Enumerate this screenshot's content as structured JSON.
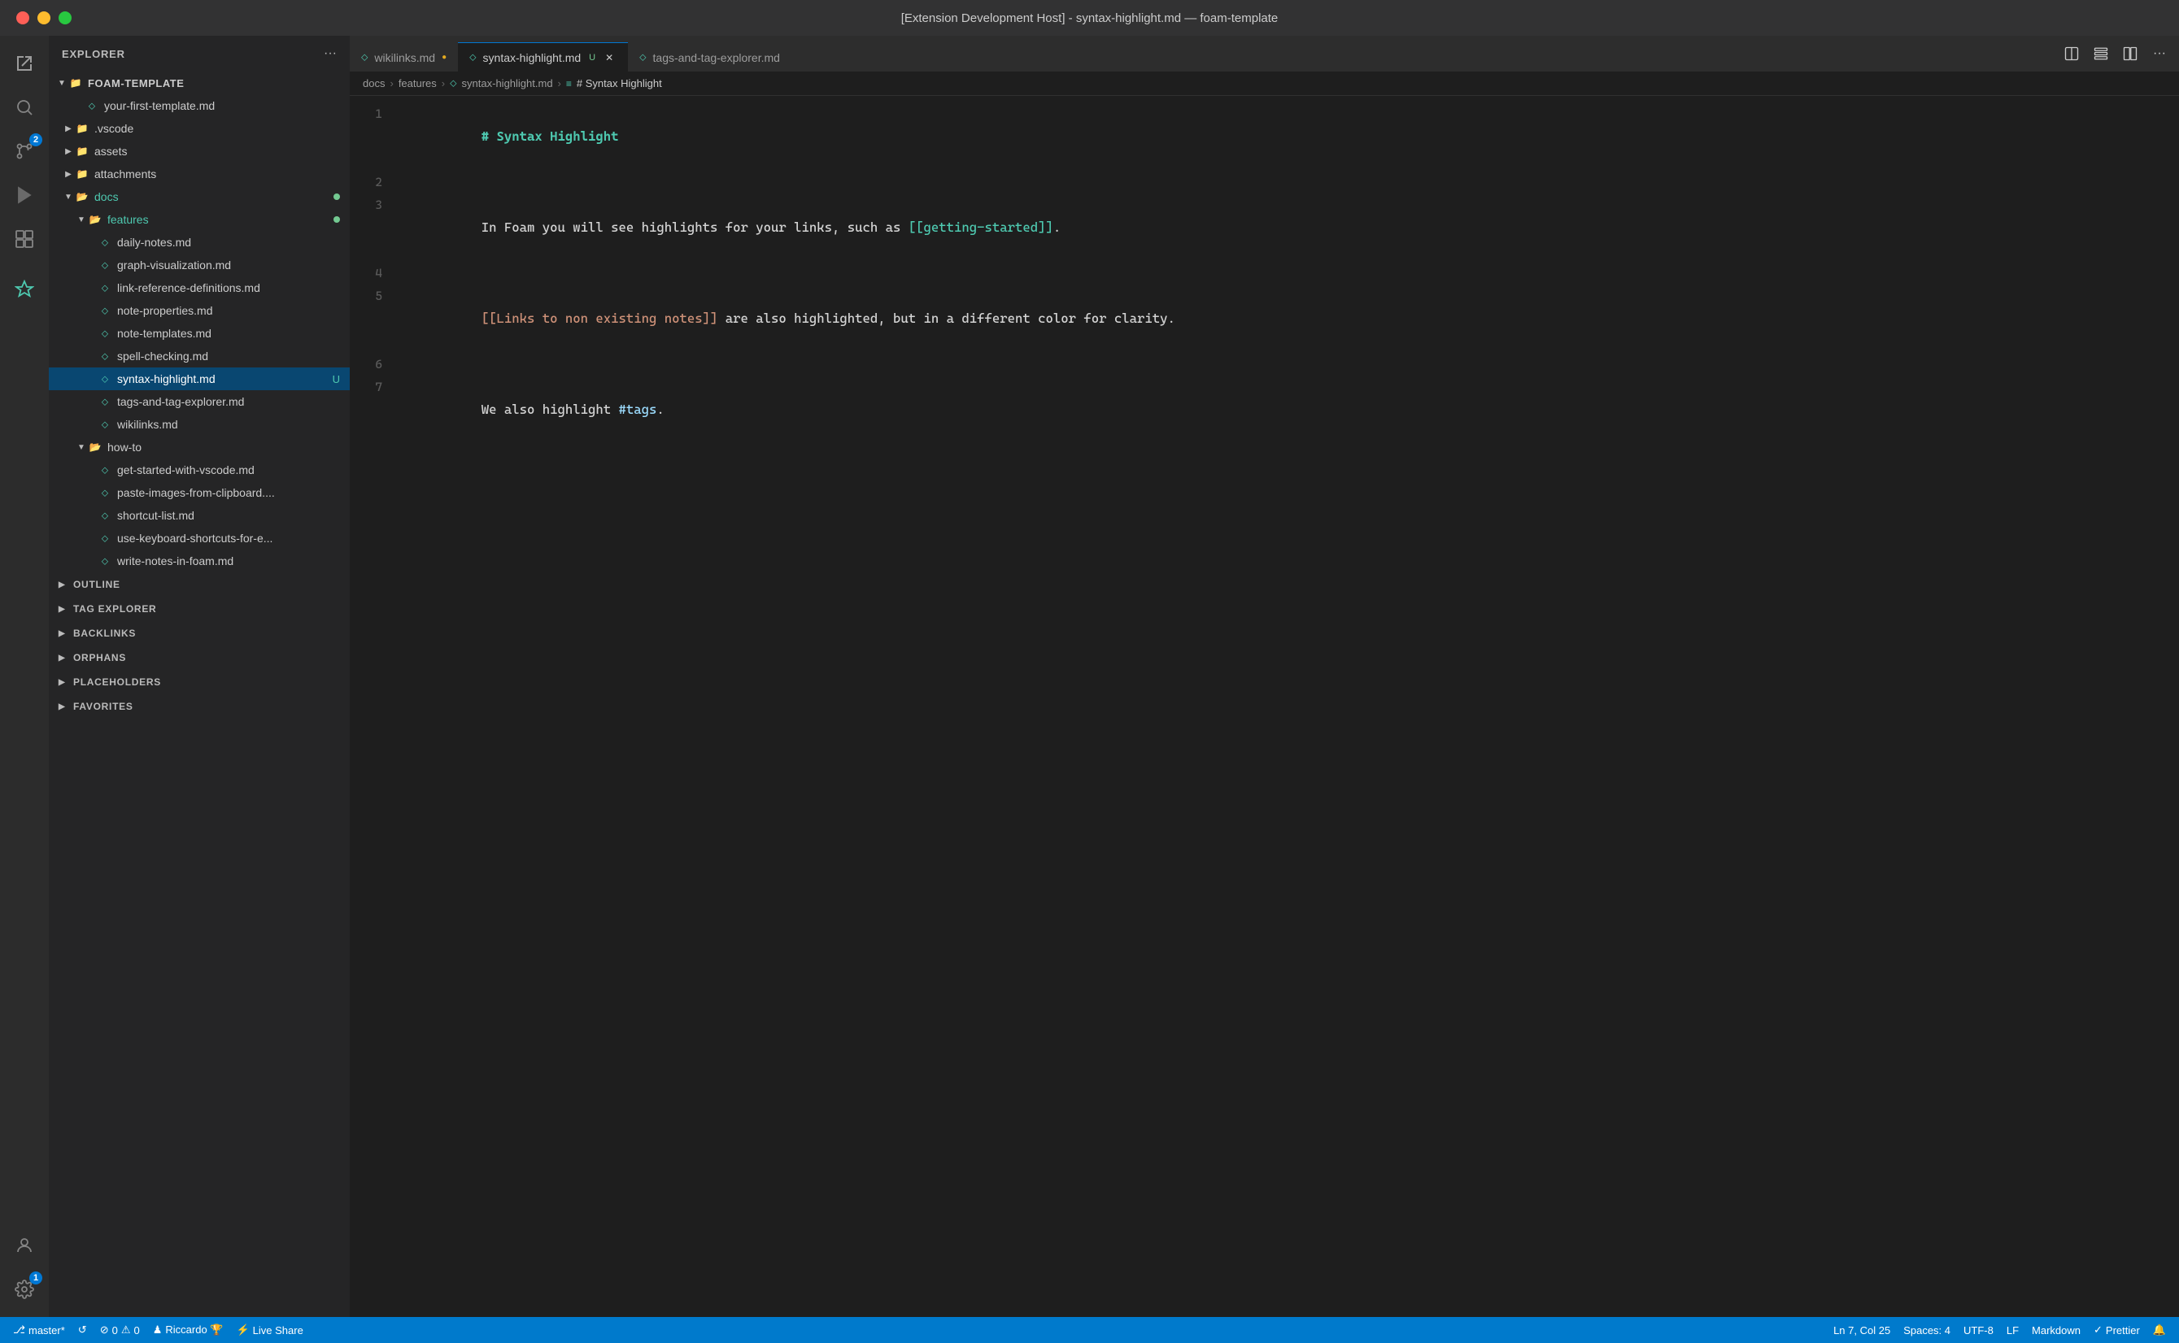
{
  "titlebar": {
    "title": "[Extension Development Host] - syntax-highlight.md — foam-template"
  },
  "activity_bar": {
    "icons": [
      {
        "name": "explorer-icon",
        "symbol": "⎘",
        "active": true,
        "badge": null
      },
      {
        "name": "search-icon",
        "symbol": "🔍",
        "active": false,
        "badge": null
      },
      {
        "name": "source-control-icon",
        "symbol": "⑂",
        "active": false,
        "badge": "2"
      },
      {
        "name": "run-icon",
        "symbol": "▷",
        "active": false,
        "badge": null
      },
      {
        "name": "extensions-icon",
        "symbol": "⊞",
        "active": false,
        "badge": null
      },
      {
        "name": "foam-icon",
        "symbol": "◈",
        "active": false,
        "badge": null
      }
    ],
    "bottom_icons": [
      {
        "name": "account-icon",
        "symbol": "👤",
        "badge": null
      },
      {
        "name": "settings-icon",
        "symbol": "⚙",
        "badge": "1"
      }
    ]
  },
  "sidebar": {
    "header": "EXPLORER",
    "tree": {
      "root": "FOAM-TEMPLATE",
      "items": [
        {
          "id": "your-first-template",
          "label": "your-first-template.md",
          "depth": 1,
          "type": "file",
          "indent": 28
        },
        {
          "id": "vscode",
          "label": ".vscode",
          "depth": 1,
          "type": "folder-closed",
          "indent": 16
        },
        {
          "id": "assets",
          "label": "assets",
          "depth": 1,
          "type": "folder-closed",
          "indent": 16
        },
        {
          "id": "attachments",
          "label": "attachments",
          "depth": 1,
          "type": "folder-closed",
          "indent": 16
        },
        {
          "id": "docs",
          "label": "docs",
          "depth": 1,
          "type": "folder-open",
          "indent": 16,
          "dot": true
        },
        {
          "id": "features",
          "label": "features",
          "depth": 2,
          "type": "folder-open",
          "indent": 32,
          "dot": true
        },
        {
          "id": "daily-notes",
          "label": "daily-notes.md",
          "depth": 3,
          "type": "file",
          "indent": 60
        },
        {
          "id": "graph-viz",
          "label": "graph-visualization.md",
          "depth": 3,
          "type": "file",
          "indent": 60
        },
        {
          "id": "link-ref",
          "label": "link-reference-definitions.md",
          "depth": 3,
          "type": "file",
          "indent": 60
        },
        {
          "id": "note-props",
          "label": "note-properties.md",
          "depth": 3,
          "type": "file",
          "indent": 60
        },
        {
          "id": "note-templ",
          "label": "note-templates.md",
          "depth": 3,
          "type": "file",
          "indent": 60
        },
        {
          "id": "spell-check",
          "label": "spell-checking.md",
          "depth": 3,
          "type": "file",
          "indent": 60
        },
        {
          "id": "syntax-highlight",
          "label": "syntax-highlight.md",
          "depth": 3,
          "type": "file",
          "indent": 60,
          "selected": true,
          "badge": "U"
        },
        {
          "id": "tags-explorer",
          "label": "tags-and-tag-explorer.md",
          "depth": 3,
          "type": "file",
          "indent": 60
        },
        {
          "id": "wikilinks",
          "label": "wikilinks.md",
          "depth": 3,
          "type": "file",
          "indent": 60
        },
        {
          "id": "how-to",
          "label": "how-to",
          "depth": 2,
          "type": "folder-open",
          "indent": 32
        },
        {
          "id": "get-started",
          "label": "get-started-with-vscode.md",
          "depth": 3,
          "type": "file",
          "indent": 60
        },
        {
          "id": "paste-images",
          "label": "paste-images-from-clipboard....",
          "depth": 3,
          "type": "file",
          "indent": 60
        },
        {
          "id": "shortcut-list",
          "label": "shortcut-list.md",
          "depth": 3,
          "type": "file",
          "indent": 60
        },
        {
          "id": "use-keyboard",
          "label": "use-keyboard-shortcuts-for-e...",
          "depth": 3,
          "type": "file",
          "indent": 60
        },
        {
          "id": "write-notes",
          "label": "write-notes-in-foam.md",
          "depth": 3,
          "type": "file",
          "indent": 60
        }
      ]
    },
    "sections": [
      {
        "id": "outline",
        "label": "OUTLINE",
        "expanded": false
      },
      {
        "id": "tag-explorer",
        "label": "TAG EXPLORER",
        "expanded": false
      },
      {
        "id": "backlinks",
        "label": "BACKLINKS",
        "expanded": false
      },
      {
        "id": "orphans",
        "label": "ORPHANS",
        "expanded": false
      },
      {
        "id": "placeholders",
        "label": "PLACEHOLDERS",
        "expanded": false
      },
      {
        "id": "favorites",
        "label": "FAVORITES",
        "expanded": false
      }
    ]
  },
  "tabs": [
    {
      "id": "wikilinks",
      "label": "wikilinks.md",
      "dirty": true,
      "active": false
    },
    {
      "id": "syntax-highlight",
      "label": "syntax-highlight.md",
      "dirty": false,
      "modified": true,
      "active": true
    },
    {
      "id": "tags-and-tag-explorer",
      "label": "tags-and-tag-explorer.md",
      "dirty": false,
      "active": false
    }
  ],
  "breadcrumb": {
    "items": [
      "docs",
      "features",
      "syntax-highlight.md",
      "# Syntax Highlight"
    ]
  },
  "editor": {
    "lines": [
      {
        "num": 1,
        "tokens": [
          {
            "text": "# Syntax Highlight",
            "class": "heading"
          }
        ]
      },
      {
        "num": 2,
        "tokens": []
      },
      {
        "num": 3,
        "tokens": [
          {
            "text": "In Foam you will see highlights for your links, such as ",
            "class": "normal-text"
          },
          {
            "text": "[[getting-started]]",
            "class": "link-existing"
          },
          {
            "text": ".",
            "class": "normal-text"
          }
        ]
      },
      {
        "num": 4,
        "tokens": []
      },
      {
        "num": 5,
        "tokens": [
          {
            "text": "[[Links to non existing notes]]",
            "class": "link-nonexist"
          },
          {
            "text": " are also highlighted, but in a different color for clarity.",
            "class": "normal-text"
          }
        ]
      },
      {
        "num": 6,
        "tokens": []
      },
      {
        "num": 7,
        "tokens": [
          {
            "text": "We also highlight ",
            "class": "normal-text"
          },
          {
            "text": "#tags",
            "class": "tag"
          },
          {
            "text": ".",
            "class": "normal-text"
          }
        ]
      }
    ]
  },
  "statusbar": {
    "left": [
      {
        "id": "branch",
        "icon": "⎇",
        "text": "master*"
      },
      {
        "id": "sync",
        "icon": "↺",
        "text": ""
      },
      {
        "id": "errors",
        "icon": "⊘",
        "text": "0"
      },
      {
        "id": "warnings",
        "icon": "⚠",
        "text": "0"
      },
      {
        "id": "user",
        "icon": "♟",
        "text": "Riccardo 🏆"
      },
      {
        "id": "liveshare",
        "icon": "⚡",
        "text": "Live Share"
      }
    ],
    "right": [
      {
        "id": "position",
        "text": "Ln 7, Col 25"
      },
      {
        "id": "spaces",
        "text": "Spaces: 4"
      },
      {
        "id": "encoding",
        "text": "UTF-8"
      },
      {
        "id": "eol",
        "text": "LF"
      },
      {
        "id": "language",
        "text": "Markdown"
      },
      {
        "id": "prettier",
        "icon": "✓",
        "text": "Prettier"
      },
      {
        "id": "bell",
        "icon": "🔔",
        "text": ""
      }
    ]
  }
}
